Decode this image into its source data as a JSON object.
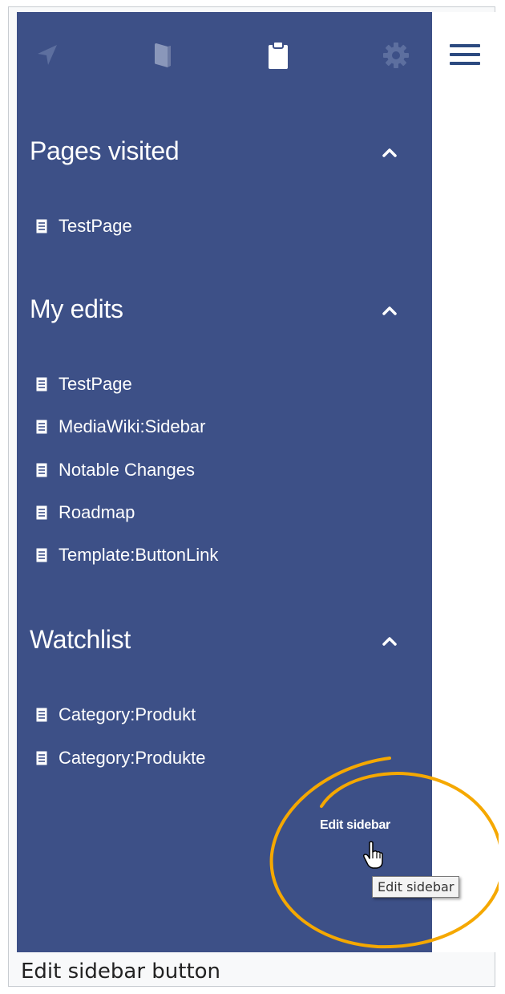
{
  "topbar": {
    "icons": [
      "navigation-arrow-icon",
      "book-icon",
      "clipboard-icon",
      "gear-icon"
    ],
    "menu_icon": "hamburger-icon"
  },
  "sections": {
    "pages_visited": {
      "title": "Pages visited",
      "items": [
        "TestPage"
      ]
    },
    "my_edits": {
      "title": "My edits",
      "items": [
        "TestPage",
        "MediaWiki:Sidebar",
        "Notable Changes",
        "Roadmap",
        "Template:ButtonLink"
      ]
    },
    "watchlist": {
      "title": "Watchlist",
      "items": [
        "Category:Produkt",
        "Category:Produkte"
      ]
    }
  },
  "edit_sidebar": {
    "link_label": "Edit sidebar",
    "tooltip": "Edit sidebar"
  },
  "caption": "Edit sidebar button",
  "colors": {
    "sidebar_bg": "#3d5087",
    "highlight_circle": "#f5a800",
    "hamburger": "#2c4a80"
  }
}
